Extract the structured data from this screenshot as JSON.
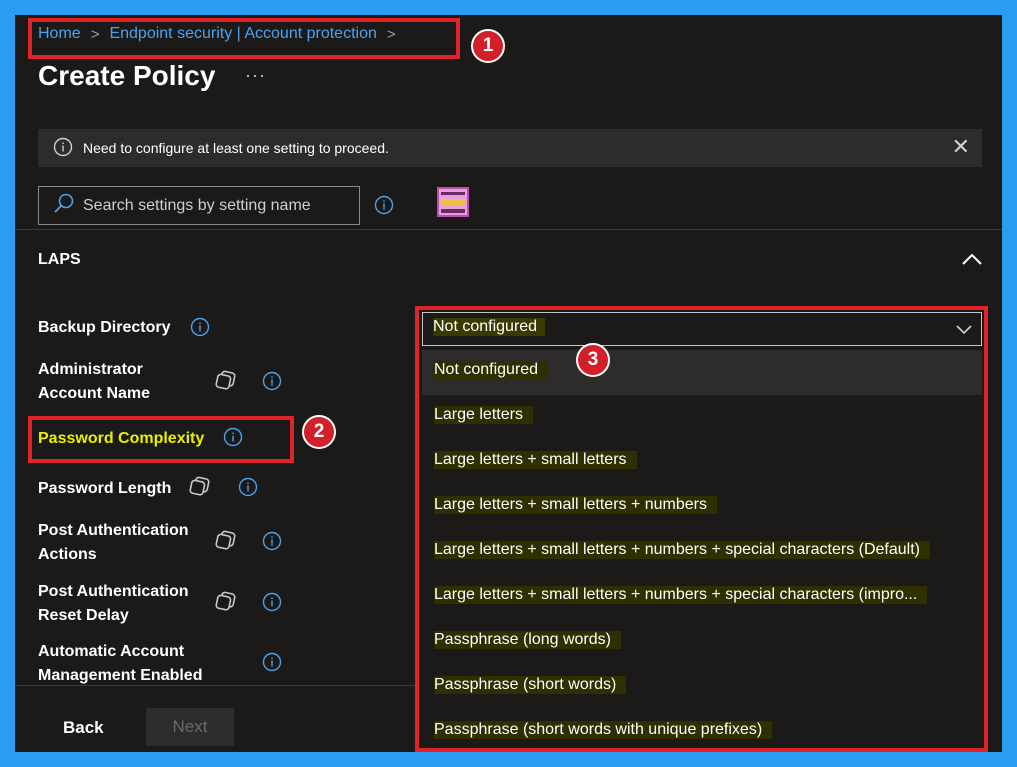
{
  "breadcrumb": {
    "home": "Home",
    "section": "Endpoint security | Account protection"
  },
  "page": {
    "title": "Create Policy",
    "more": "···"
  },
  "notice": {
    "text": "Need to configure at least one setting to proceed.",
    "close": "✕"
  },
  "search": {
    "placeholder": "Search settings by setting name"
  },
  "group": {
    "name": "LAPS"
  },
  "settings": [
    {
      "label": "Backup Directory"
    },
    {
      "label": "Administrator Account Name"
    },
    {
      "label": "Password Complexity"
    },
    {
      "label": "Password Length"
    },
    {
      "label": "Post Authentication Actions"
    },
    {
      "label": "Post Authentication Reset Delay"
    },
    {
      "label": "Automatic Account Management Enabled"
    }
  ],
  "dropdown": {
    "selected": "Not configured",
    "options": [
      "Not configured",
      "Large letters",
      "Large letters + small letters",
      "Large letters + small letters + numbers",
      "Large letters + small letters + numbers + special characters (Default)",
      "Large letters + small letters + numbers + special characters (impro...",
      "Passphrase (long words)",
      "Passphrase (short words)",
      "Passphrase (short words with unique prefixes)"
    ]
  },
  "badges": [
    "1",
    "2",
    "3"
  ],
  "footer": {
    "back": "Back",
    "next": "Next"
  },
  "colors": {
    "background": "#1b1a19",
    "link": "#4aa3ee",
    "highlight": "#e8f000",
    "annotation": "#e0242a",
    "frame": "#2b9cf0"
  }
}
